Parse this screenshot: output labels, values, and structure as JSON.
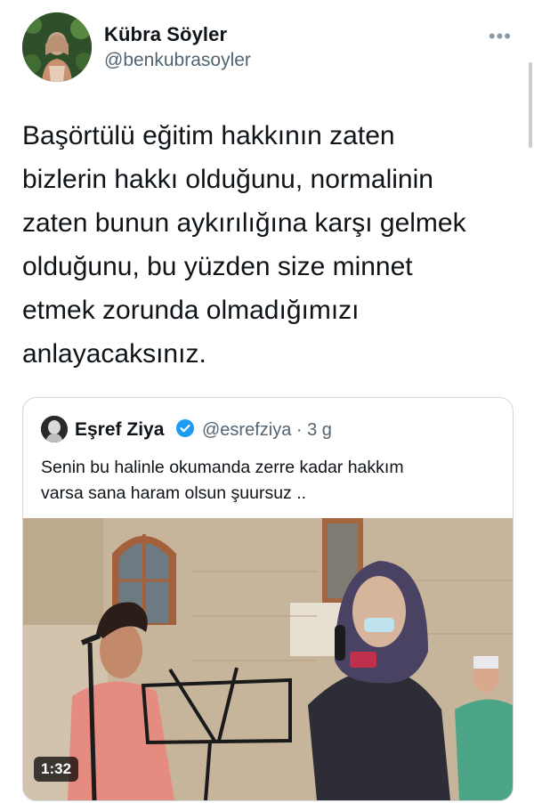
{
  "tweet": {
    "author": {
      "name": "Kübra Söyler",
      "handle": "@benkubrasoyler"
    },
    "more_icon": "more-horizontal-icon",
    "lines": [
      "Başörtülü eğitim hakkının zaten",
      "bizlerin hakkı olduğunu, normalinin",
      "zaten bunun aykırılığına karşı gelmek",
      "olduğunu, bu yüzden size minnet",
      "etmek zorunda olmadığımızı",
      "anlayacaksınız."
    ]
  },
  "quote": {
    "name": "Eşref Ziya",
    "handle_meta": "@esrefziya · 3 g",
    "verified": true,
    "lines": [
      "Senin bu halinle okumanda zerre kadar hakkım",
      "varsa sana haram olsun şuursuz .."
    ],
    "video": {
      "duration": "1:32"
    }
  },
  "colors": {
    "accent": "#1d9bf0",
    "secondary_text": "#536471",
    "border": "#cfd9de"
  }
}
